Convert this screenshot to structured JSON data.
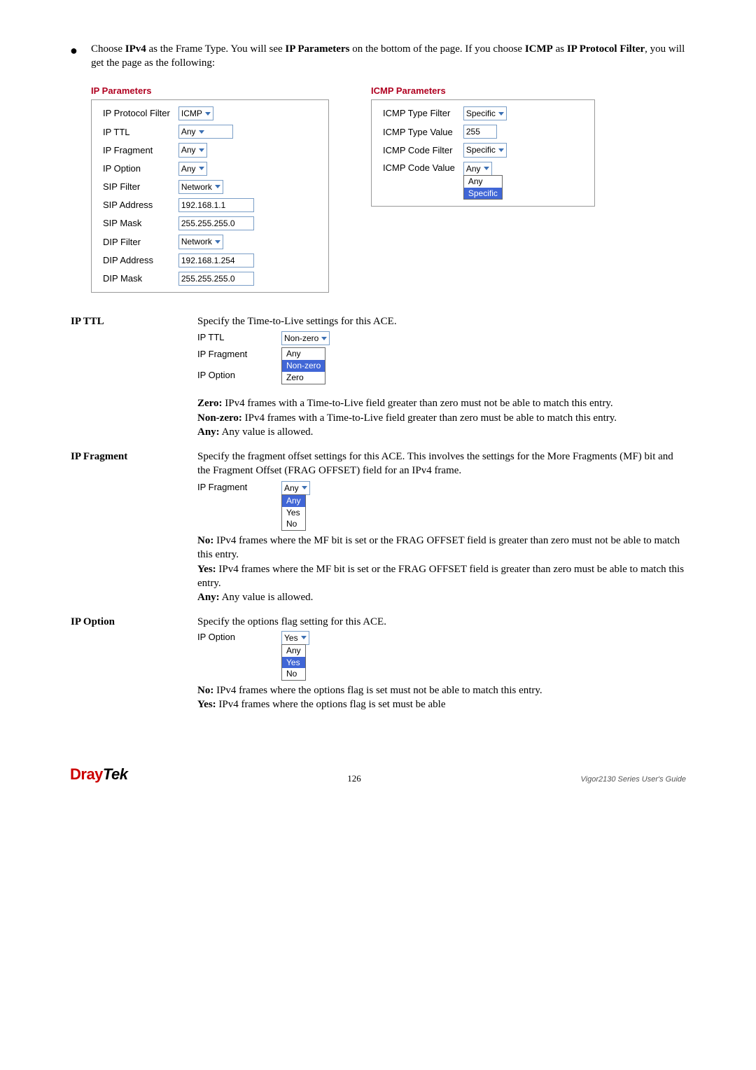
{
  "bullet": {
    "pre1": "Choose ",
    "b1": "IPv4",
    "mid1": " as the Frame Type. You will see ",
    "b2": "IP Parameters",
    "post1": " on the bottom of the page. If you choose ",
    "b3": "ICMP",
    "mid2": " as ",
    "b4": "IP Protocol Filter",
    "post2": ", you will get the page as the following:"
  },
  "ip_params": {
    "title": "IP Parameters",
    "rows": {
      "ip_protocol_filter": {
        "label": "IP Protocol Filter",
        "value": "ICMP"
      },
      "ip_ttl": {
        "label": "IP TTL",
        "value": "Any"
      },
      "ip_fragment": {
        "label": "IP Fragment",
        "value": "Any"
      },
      "ip_option": {
        "label": "IP Option",
        "value": "Any"
      },
      "sip_filter": {
        "label": "SIP Filter",
        "value": "Network"
      },
      "sip_address": {
        "label": "SIP Address",
        "value": "192.168.1.1"
      },
      "sip_mask": {
        "label": "SIP Mask",
        "value": "255.255.255.0"
      },
      "dip_filter": {
        "label": "DIP Filter",
        "value": "Network"
      },
      "dip_address": {
        "label": "DIP Address",
        "value": "192.168.1.254"
      },
      "dip_mask": {
        "label": "DIP Mask",
        "value": "255.255.255.0"
      }
    }
  },
  "icmp_params": {
    "title": "ICMP Parameters",
    "rows": {
      "type_filter": {
        "label": "ICMP Type Filter",
        "value": "Specific"
      },
      "type_value": {
        "label": "ICMP Type Value",
        "value": "255"
      },
      "code_filter": {
        "label": "ICMP Code Filter",
        "value": "Specific"
      },
      "code_value": {
        "label": "ICMP Code Value",
        "value": "Any",
        "options": [
          "Any",
          "Specific"
        ],
        "selected": "Specific"
      }
    }
  },
  "defs": {
    "ipttl": {
      "label": "IP TTL",
      "lead": "Specify the Time-to-Live settings for this ACE.",
      "widget": {
        "ttl_label": "IP TTL",
        "ttl_value": "Non-zero",
        "frag_label": "IP Fragment",
        "opt_label": "IP Option",
        "options": [
          "Any",
          "Non-zero",
          "Zero"
        ],
        "selected": "Non-zero"
      },
      "desc": {
        "zero_b": "Zero:",
        "zero": " IPv4 frames with a Time-to-Live field greater than zero must not be able to match this entry.",
        "nz_b": "Non-zero:",
        "nz": " IPv4 frames with a Time-to-Live field greater than zero must be able to match this entry.",
        "any_b": "Any:",
        "any": " Any value is allowed."
      }
    },
    "ipfrag": {
      "label": "IP Fragment",
      "lead": "Specify the fragment offset settings for this ACE. This involves the settings for the More Fragments (MF) bit and the Fragment Offset (FRAG OFFSET) field for an IPv4 frame.",
      "widget": {
        "label": "IP Fragment",
        "value": "Any",
        "options": [
          "Any",
          "Yes",
          "No"
        ],
        "selected": "Any"
      },
      "desc": {
        "no_b": "No:",
        "no": " IPv4 frames where the MF bit is set or the FRAG OFFSET field is greater than zero must not be able to match this entry.",
        "yes_b": "Yes:",
        "yes": " IPv4 frames where the MF bit is set or the FRAG OFFSET field is greater than zero must be able to match this entry.",
        "any_b": "Any:",
        "any": " Any value is allowed."
      }
    },
    "ipopt": {
      "label": "IP Option",
      "lead": "Specify the options flag setting for this ACE.",
      "widget": {
        "label": "IP Option",
        "value": "Yes",
        "options": [
          "Any",
          "Yes",
          "No"
        ],
        "selected": "Yes"
      },
      "desc": {
        "no_b": "No:",
        "no": " IPv4 frames where the options flag is set must not be able to match this entry.",
        "yes_b": "Yes:",
        "yes": " IPv4 frames where the options flag is set must be able"
      }
    }
  },
  "footer": {
    "brand1": "Dray",
    "brand2": "Tek",
    "page": "126",
    "guide": "Vigor2130  Series  User's  Guide"
  }
}
